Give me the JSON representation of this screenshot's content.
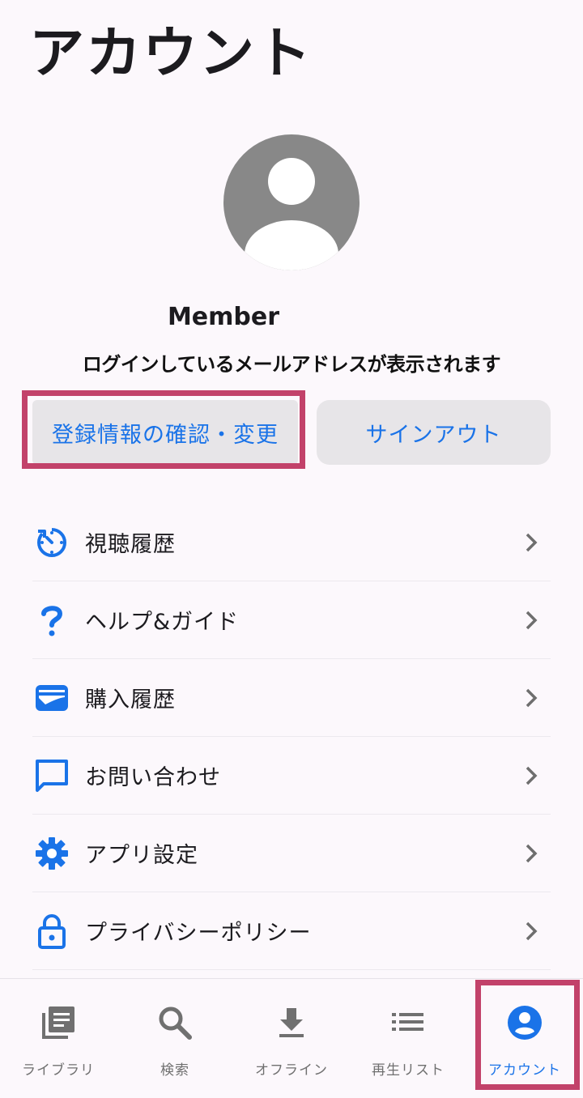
{
  "header": {
    "title": "アカウント"
  },
  "profile": {
    "name": "Member",
    "email_note": "ログインしているメールアドレスが表示されます"
  },
  "buttons": {
    "edit_label": "登録情報の確認・変更",
    "signout_label": "サインアウト"
  },
  "menu": {
    "items": [
      {
        "label": "視聴履歴",
        "icon": "history-icon"
      },
      {
        "label": "ヘルプ&ガイド",
        "icon": "help-icon"
      },
      {
        "label": "購入履歴",
        "icon": "wallet-icon"
      },
      {
        "label": "お問い合わせ",
        "icon": "chat-icon"
      },
      {
        "label": "アプリ設定",
        "icon": "gear-icon"
      },
      {
        "label": "プライバシーポリシー",
        "icon": "lock-icon"
      }
    ]
  },
  "nav": {
    "items": [
      {
        "label": "ライブラリ",
        "icon": "library-icon"
      },
      {
        "label": "検索",
        "icon": "search-icon"
      },
      {
        "label": "オフライン",
        "icon": "download-icon"
      },
      {
        "label": "再生リスト",
        "icon": "playlist-icon"
      },
      {
        "label": "アカウント",
        "icon": "account-icon",
        "active": true
      }
    ]
  },
  "colors": {
    "accent": "#1a73e8",
    "highlight": "#c2426a",
    "button_bg": "#e7e5e8",
    "avatar": "#888888"
  }
}
